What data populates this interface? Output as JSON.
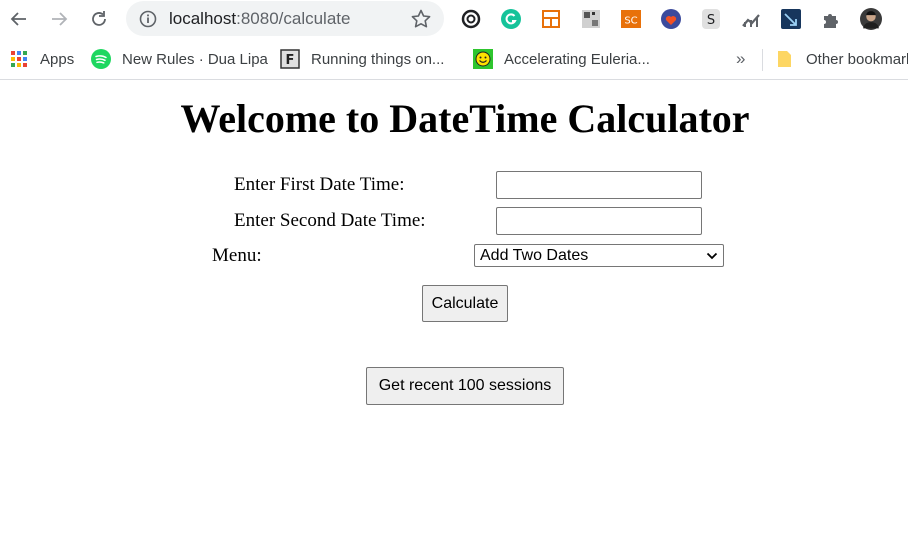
{
  "browser": {
    "url_host": "localhost",
    "url_path": ":8080/calculate",
    "bookmarks": [
      {
        "label": "Apps",
        "icon": "apps-grid-icon"
      },
      {
        "label": "New Rules · Dua Lipa",
        "icon": "spotify-icon"
      },
      {
        "label": "Running things on...",
        "icon": "f-logo-icon"
      },
      {
        "label": "Accelerating Euleria...",
        "icon": "smiley-icon"
      }
    ],
    "other_bookmarks": "Other bookmarks",
    "extension_icons": [
      "link-extension-icon",
      "grammarly-icon",
      "layout-extension-icon",
      "image-extension-icon",
      "sc-extension-icon",
      "heart-extension-icon",
      "s-extension-icon",
      "chart-extension-icon",
      "arrow-extension-icon",
      "puzzle-icon",
      "profile-avatar"
    ]
  },
  "page": {
    "title": "Welcome to DateTime Calculator",
    "first_label": "Enter First Date Time:",
    "first_value": "",
    "second_label": "Enter Second Date Time:",
    "second_value": "",
    "menu_label": "Menu:",
    "menu_selected": "Add Two Dates",
    "calculate_label": "Calculate",
    "sessions_label": "Get recent 100 sessions"
  },
  "colors": {
    "chrome_gray": "#5f6368",
    "omnibox_bg": "#f1f3f4",
    "button_bg": "#efefef"
  }
}
